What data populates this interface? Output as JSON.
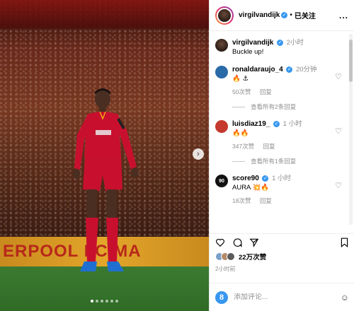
{
  "post": {
    "ad_board_text": "ERPOOL FC MA",
    "carousel_dots": 6
  },
  "header": {
    "username": "virgilvandijk",
    "separator": "•",
    "follow_label": "已关注",
    "more_label": "..."
  },
  "caption": {
    "username": "virgilvandijk",
    "time": "2小时",
    "text": "Buckle up!"
  },
  "comments": [
    {
      "username": "ronaldaraujo_4",
      "time": "20分钟",
      "text": "🔥 ⚓",
      "likes": "50次赞",
      "reply_label": "回复",
      "view_replies": "查看所有2条回复",
      "avatar_color": "#2a6aa8"
    },
    {
      "username": "luisdiaz19_",
      "time": "1 小时",
      "text": "🔥🔥",
      "likes": "347次赞",
      "reply_label": "回复",
      "view_replies": "查看所有1条回复",
      "avatar_color": "#c43a2e"
    },
    {
      "username": "score90",
      "time": "1 小时",
      "text": "AURA 💥🔥",
      "likes": "18次赞",
      "reply_label": "回复",
      "view_replies": "",
      "avatar_color": "#111111",
      "avatar_text": "90"
    }
  ],
  "likes_text": "22万次赞",
  "posted_time": "2小时前",
  "composer": {
    "placeholder": "添加评论...",
    "avatar_letter": "8"
  },
  "colors": {
    "verified": "#3897f0",
    "kit_red": "#c8102e",
    "pitch": "#2f6b26",
    "ad_board": "#e3a62a"
  }
}
